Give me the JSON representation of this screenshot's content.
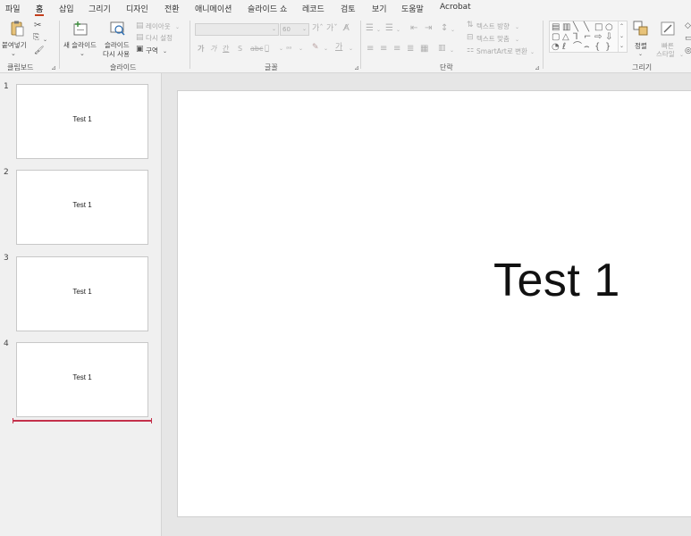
{
  "menu": {
    "tabs": [
      {
        "label": "파일"
      },
      {
        "label": "홈",
        "active": true
      },
      {
        "label": "삽입"
      },
      {
        "label": "그리기"
      },
      {
        "label": "디자인"
      },
      {
        "label": "전환"
      },
      {
        "label": "애니메이션"
      },
      {
        "label": "슬라이드 쇼"
      },
      {
        "label": "레코드"
      },
      {
        "label": "검토"
      },
      {
        "label": "보기"
      },
      {
        "label": "도움말"
      },
      {
        "label": "Acrobat"
      }
    ],
    "accent_color": "#c43e1c"
  },
  "ribbon": {
    "clipboard": {
      "paste_label": "붙여넣기",
      "group_label": "클립보드"
    },
    "slides": {
      "new_slide_label": "새 슬라이드",
      "reuse_label_1": "슬라이드",
      "reuse_label_2": "다시 사용",
      "layout_label": "레이아웃",
      "reset_label": "다시 설정",
      "section_label": "구역",
      "group_label": "슬라이드"
    },
    "font": {
      "font_size": "60",
      "group_label": "글꼴"
    },
    "paragraph": {
      "text_direction_label": "텍스트 방향",
      "align_text_label": "텍스트 맞춤",
      "smartart_label": "SmartArt로 변환",
      "group_label": "단락"
    },
    "drawing": {
      "arrange_label": "정렬",
      "quick_styles_label_1": "빠른",
      "quick_styles_label_2": "스타일",
      "group_label": "그리기"
    }
  },
  "slides": [
    {
      "number": "1",
      "title": "Test 1"
    },
    {
      "number": "2",
      "title": "Test 1"
    },
    {
      "number": "3",
      "title": "Test 1"
    },
    {
      "number": "4",
      "title": "Test 1"
    }
  ],
  "current_slide": {
    "title": "Test 1"
  }
}
